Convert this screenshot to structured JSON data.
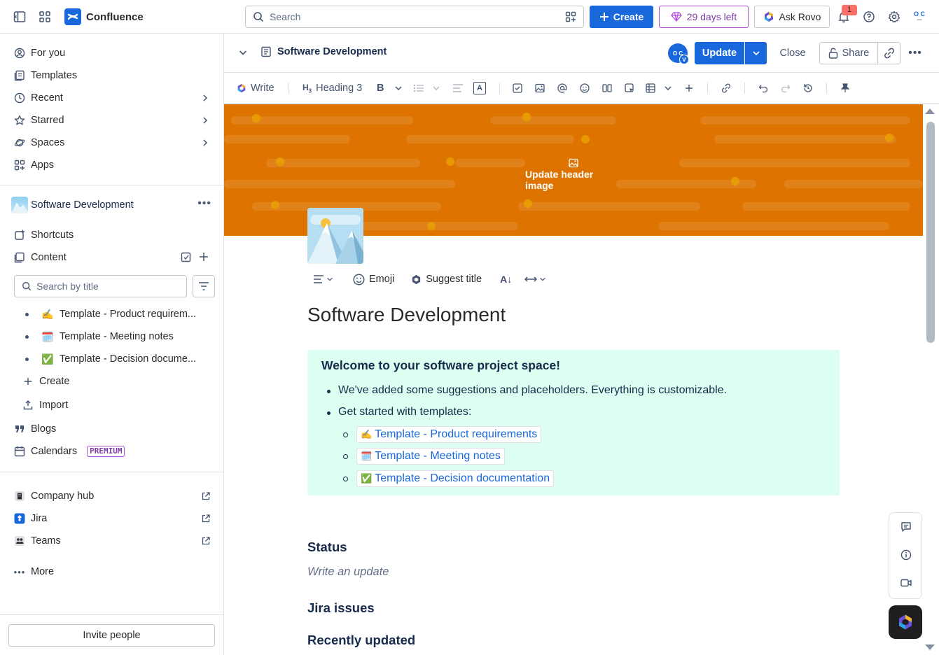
{
  "topbar": {
    "app_name": "Confluence",
    "search_placeholder": "Search",
    "create_label": "Create",
    "trial_label": "29 days left",
    "rovo_label": "Ask Rovo",
    "notification_count": "1",
    "avatar_initials_top": "O C",
    "avatar_initials_bottom": "••••"
  },
  "sidebar": {
    "nav": [
      {
        "label": "For you",
        "icon": "user-circle-icon"
      },
      {
        "label": "Templates",
        "icon": "templates-icon"
      },
      {
        "label": "Recent",
        "icon": "clock-icon"
      },
      {
        "label": "Starred",
        "icon": "star-icon"
      },
      {
        "label": "Spaces",
        "icon": "planet-icon"
      },
      {
        "label": "Apps",
        "icon": "apps-icon"
      }
    ],
    "space_name": "Software Development",
    "shortcuts_label": "Shortcuts",
    "content_label": "Content",
    "search_placeholder": "Search by title",
    "tree": [
      {
        "emoji": "✍️",
        "label": "Template - Product requirem..."
      },
      {
        "emoji": "🗓️",
        "label": "Template - Meeting notes"
      },
      {
        "emoji": "✅",
        "label": "Template - Decision docume..."
      }
    ],
    "create_label": "Create",
    "import_label": "Import",
    "blogs_label": "Blogs",
    "calendars_label": "Calendars",
    "premium_label": "PREMIUM",
    "external": [
      {
        "label": "Company hub"
      },
      {
        "label": "Jira"
      },
      {
        "label": "Teams"
      }
    ],
    "more_label": "More",
    "invite_label": "Invite people"
  },
  "page_header": {
    "title": "Software Development",
    "avatar_initials": "O C",
    "avatar_badge": "V",
    "update_label": "Update",
    "close_label": "Close",
    "share_label": "Share"
  },
  "toolbar": {
    "write_label": "Write",
    "heading_label": "Heading 3"
  },
  "editor": {
    "banner_cta": "Update header image",
    "emoji_label": "Emoji",
    "suggest_title_label": "Suggest title",
    "title": "Software Development",
    "panel_heading": "Welcome to your software project space!",
    "panel_items": [
      "We've added some suggestions and placeholders. Everything is customizable.",
      "Get started with templates:"
    ],
    "template_links": [
      {
        "emoji": "✍️",
        "label": "Template - Product requirements"
      },
      {
        "emoji": "🗓️",
        "label": "Template - Meeting notes"
      },
      {
        "emoji": "✅",
        "label": "Template - Decision documentation"
      }
    ],
    "status_heading": "Status",
    "status_placeholder": "Write an update",
    "jira_heading": "Jira issues",
    "recent_heading": "Recently updated"
  },
  "colors": {
    "brand": "#1868db",
    "banner": "#de7300",
    "panel": "#dcfff1",
    "trial": "#ae4ed9"
  }
}
